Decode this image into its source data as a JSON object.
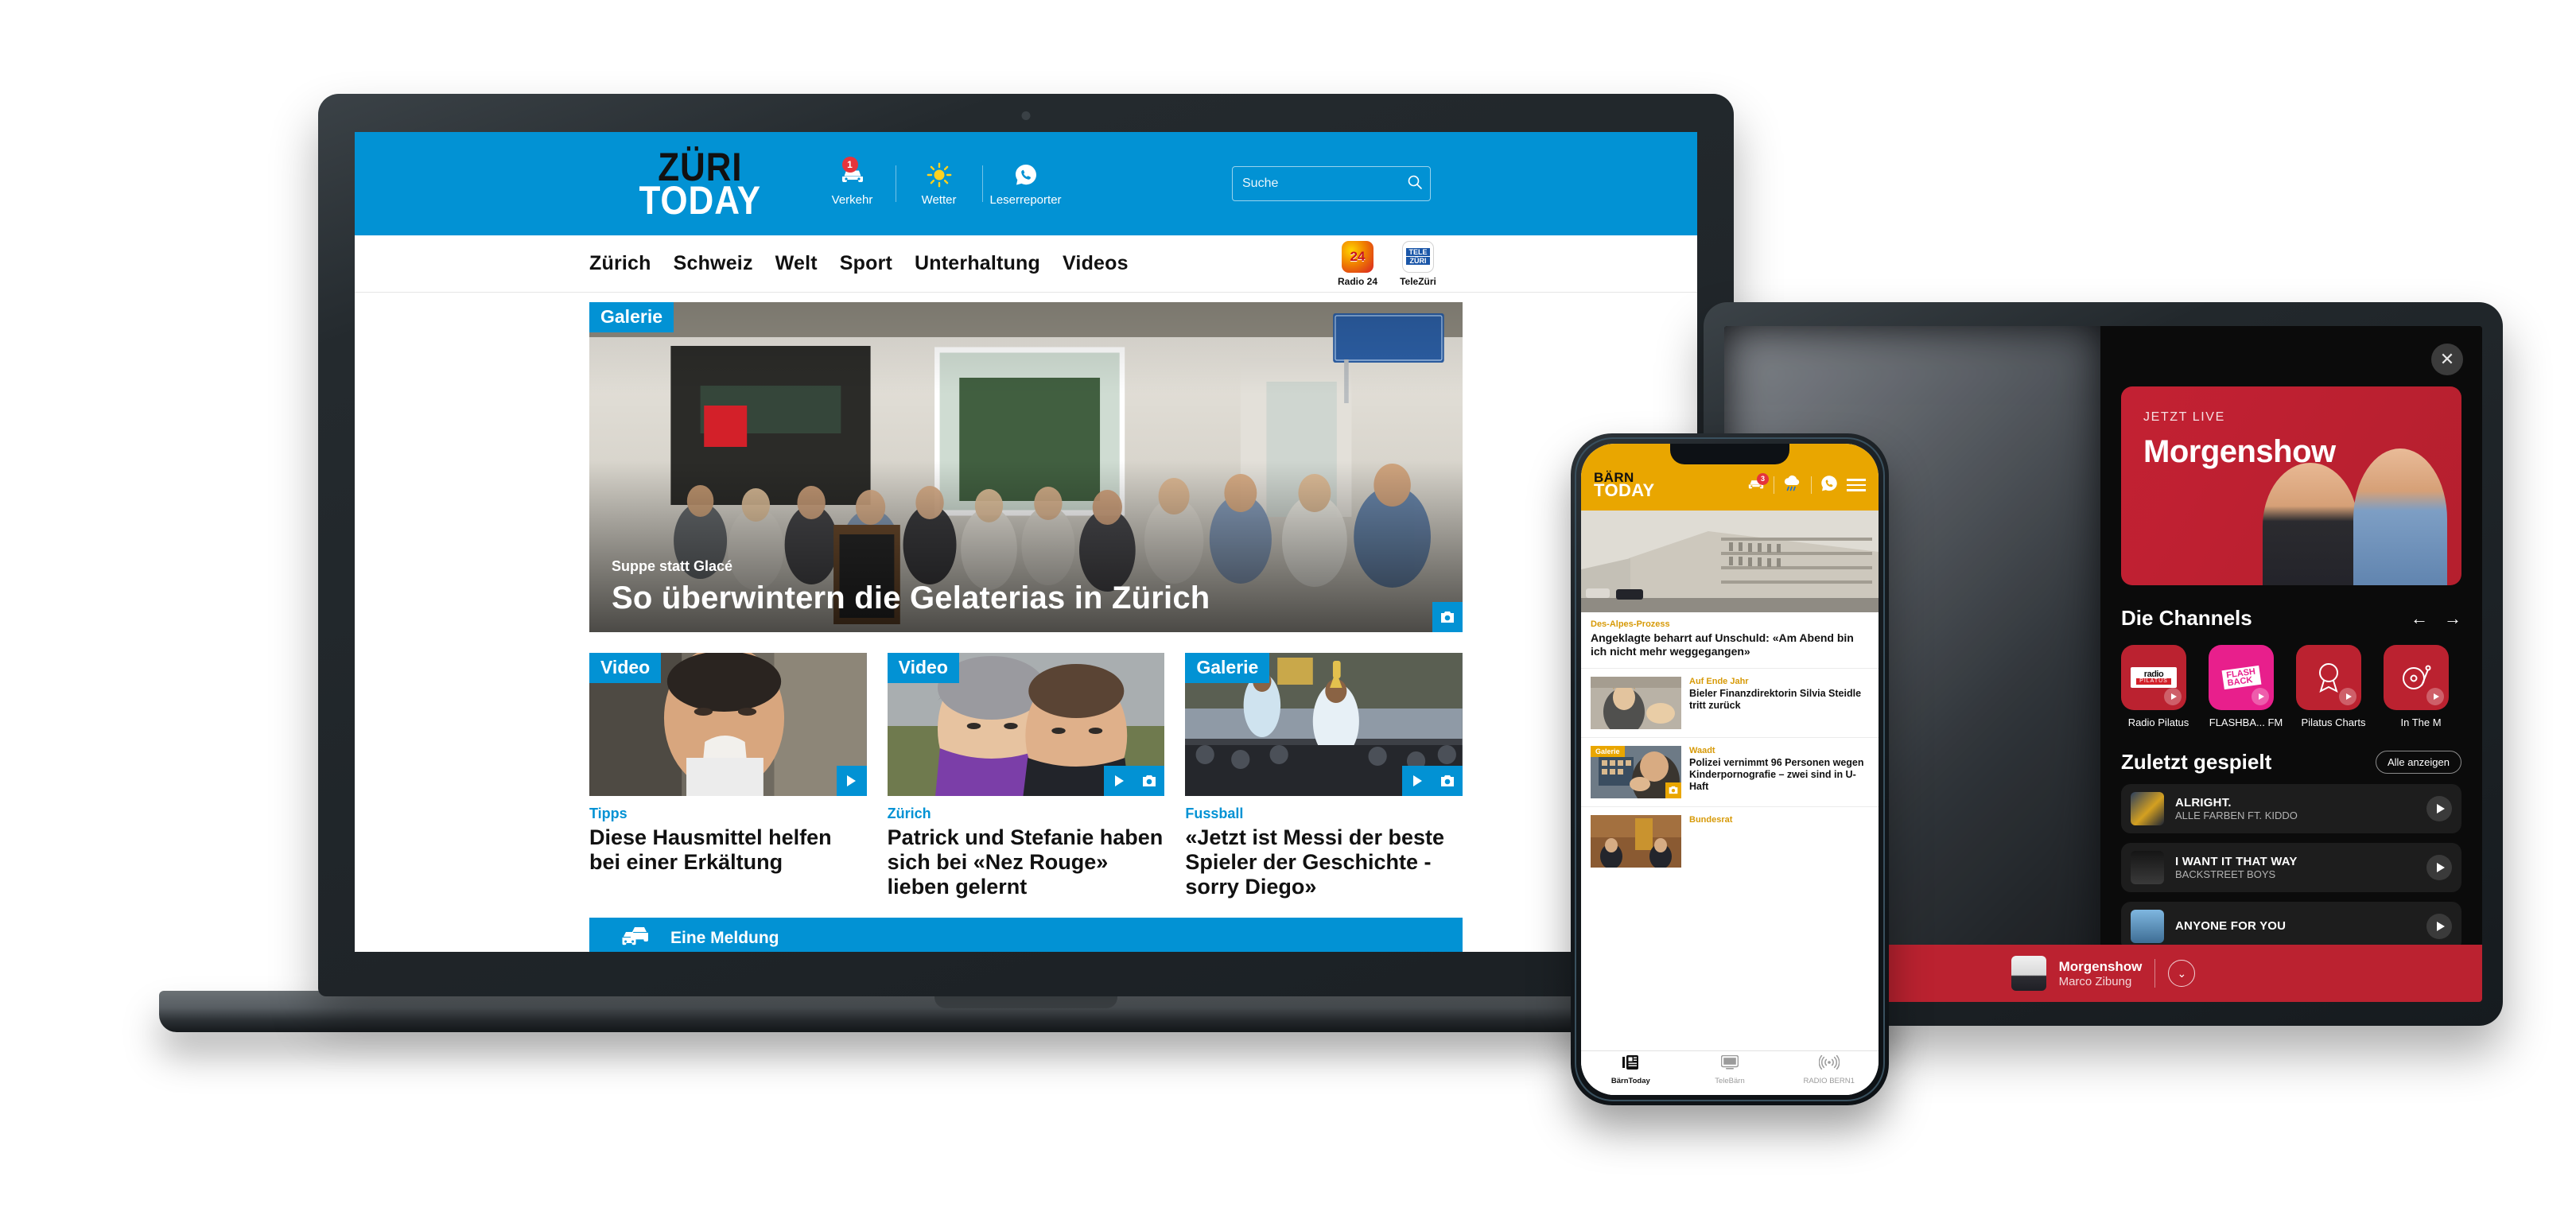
{
  "laptop": {
    "site": {
      "logo_line1": "ZÜRI",
      "logo_line2": "TODAY",
      "actions": [
        {
          "label": "Verkehr",
          "icon": "car-icon",
          "badge": "1"
        },
        {
          "label": "Wetter",
          "icon": "sun-icon",
          "badge": ""
        },
        {
          "label": "Leserreporter",
          "icon": "whatsapp-icon",
          "badge": ""
        }
      ],
      "search": {
        "placeholder": "Suche",
        "value": "",
        "icon": "search-icon"
      },
      "nav": [
        "Zürich",
        "Schweiz",
        "Welt",
        "Sport",
        "Unterhaltung",
        "Videos"
      ],
      "brands": [
        {
          "label": "Radio 24",
          "mark": "24"
        },
        {
          "label": "TeleZüri",
          "mark_top": "TELE",
          "mark_bottom": "ZÜRI"
        }
      ]
    },
    "hero": {
      "tag": "Galerie",
      "kicker": "Suppe statt Glacé",
      "title": "So überwintern die Gelaterias in Zürich",
      "media_icons": [
        "camera-icon"
      ]
    },
    "cards": [
      {
        "tag": "Video",
        "kicker": "Tipps",
        "title": "Diese Hausmittel helfen bei einer Erkältung",
        "media_icons": [
          "play-icon"
        ]
      },
      {
        "tag": "Video",
        "kicker": "Zürich",
        "title": "Patrick und Stefanie haben sich bei «Nez Rouge» lieben gelernt",
        "media_icons": [
          "play-icon",
          "camera-icon"
        ]
      },
      {
        "tag": "Galerie",
        "kicker": "Fussball",
        "title": "«Jetzt ist Messi der beste Spieler der Geschichte - sorry Diego»",
        "media_icons": [
          "play-icon",
          "camera-icon"
        ]
      }
    ],
    "traffic_bar": {
      "label": "Eine Meldung",
      "icon": "cars-icon"
    },
    "colors": {
      "brand": "#0292d4",
      "tag": "#0292d4",
      "kicker": "#0292d4"
    }
  },
  "phone": {
    "logo_line1": "BÄRN",
    "logo_line2": "TODAY",
    "actions": [
      {
        "icon": "car-icon",
        "badge": "3"
      },
      {
        "icon": "rain-cloud-icon",
        "badge": ""
      },
      {
        "icon": "whatsapp-icon",
        "badge": ""
      }
    ],
    "menu_icon": "hamburger-icon",
    "lead": {
      "kicker": "Des-Alpes-Prozess",
      "title": "Angeklagte beharrt auf Unschuld: «Am Abend bin ich nicht mehr weggegangen»"
    },
    "rows": [
      {
        "kicker": "Auf Ende Jahr",
        "title": "Bieler Finanzdirektorin Silvia Steidle tritt zurück",
        "tag": "",
        "media_icon": ""
      },
      {
        "kicker": "Waadt",
        "title": "Polizei vernimmt 96 Personen wegen Kinderpornografie – zwei sind in U-Haft",
        "tag": "Galerie",
        "media_icon": "camera-icon"
      },
      {
        "kicker": "Bundesrat",
        "title": "",
        "tag": "",
        "media_icon": ""
      }
    ],
    "tabs": [
      {
        "label": "BärnToday",
        "icon": "news-icon",
        "active": true
      },
      {
        "label": "TeleBärn",
        "icon": "tv-icon",
        "active": false
      },
      {
        "label": "RADIO BERN1",
        "icon": "broadcast-icon",
        "active": false
      }
    ],
    "colors": {
      "brand": "#e9a600",
      "kicker": "#d79a08"
    }
  },
  "tablet": {
    "close_icon": "close-icon",
    "live": {
      "kicker": "JETZT LIVE",
      "title": "Morgenshow"
    },
    "channels_section": {
      "title": "Die Channels",
      "prev_icon": "arrow-left-icon",
      "next_icon": "arrow-right-icon",
      "items": [
        {
          "label": "Radio Pilatus",
          "logo_top": "radio",
          "logo_bottom": "PILATUS",
          "color": "#bb2230"
        },
        {
          "label": "FLASHBA... FM",
          "logo_top": "FLASH",
          "logo_bottom": "BACK",
          "color": "#e81f8c"
        },
        {
          "label": "Pilatus Charts",
          "logo_top": "1",
          "logo_bottom": "",
          "color": "#bb2230"
        },
        {
          "label": "In The M",
          "logo_top": "",
          "logo_bottom": "",
          "color": "#bb2230"
        }
      ]
    },
    "played_section": {
      "title": "Zuletzt gespielt",
      "show_all": "Alle anzeigen",
      "tracks": [
        {
          "title": "ALRIGHT.",
          "artist": "ALLE FARBEN FT. KIDDO"
        },
        {
          "title": "I WANT IT THAT WAY",
          "artist": "BACKSTREET BOYS"
        },
        {
          "title": "ANYONE FOR YOU",
          "artist": ""
        }
      ]
    },
    "player": {
      "title": "Morgenshow",
      "subtitle": "Marco Zibung",
      "collapse_icon": "chevron-down-icon"
    },
    "colors": {
      "accent": "#bb2230",
      "background": "#0b0b0b"
    }
  }
}
